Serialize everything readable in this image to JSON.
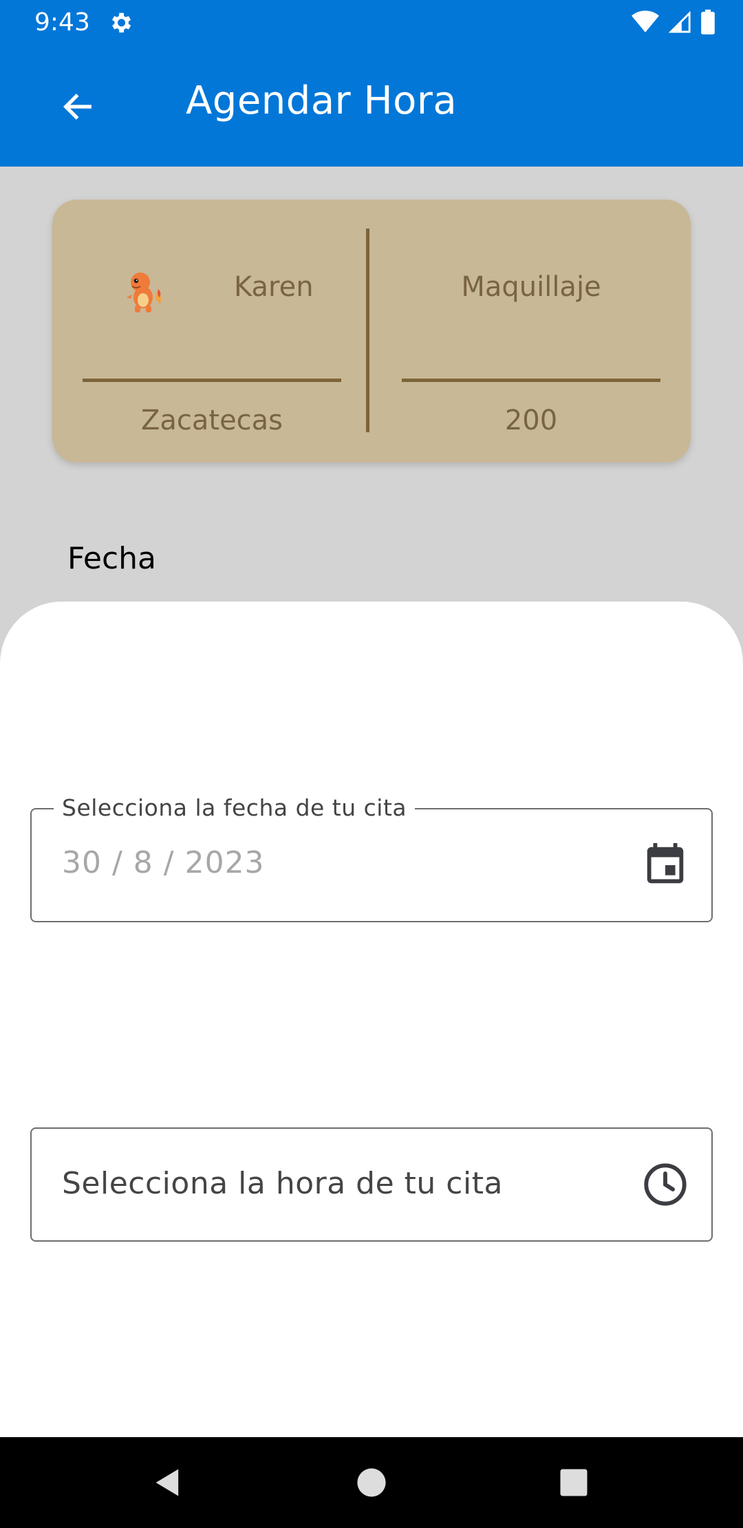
{
  "status_bar": {
    "time": "9:43",
    "icons": [
      "gear-icon",
      "wifi-icon",
      "signal-icon",
      "battery-icon"
    ]
  },
  "app_bar": {
    "title": "Agendar Hora",
    "back_icon": "arrow-left-icon",
    "background_color": "#0277d8"
  },
  "summary_card": {
    "name": "Karen",
    "service": "Maquillaje",
    "city": "Zacatecas",
    "price": "200",
    "avatar_icon": "orange-dragon-avatar",
    "background_color": "#c8b896",
    "text_color": "#7a6440"
  },
  "section": {
    "label": "Fecha"
  },
  "date_field": {
    "label": "Selecciona la fecha de tu cita",
    "value": "30 / 8 / 2023",
    "icon": "calendar-icon"
  },
  "time_field": {
    "placeholder": "Selecciona la hora de tu cita",
    "icon": "clock-icon"
  },
  "nav_bar": {
    "icons": [
      "nav-back-icon",
      "nav-home-icon",
      "nav-recent-icon"
    ]
  }
}
